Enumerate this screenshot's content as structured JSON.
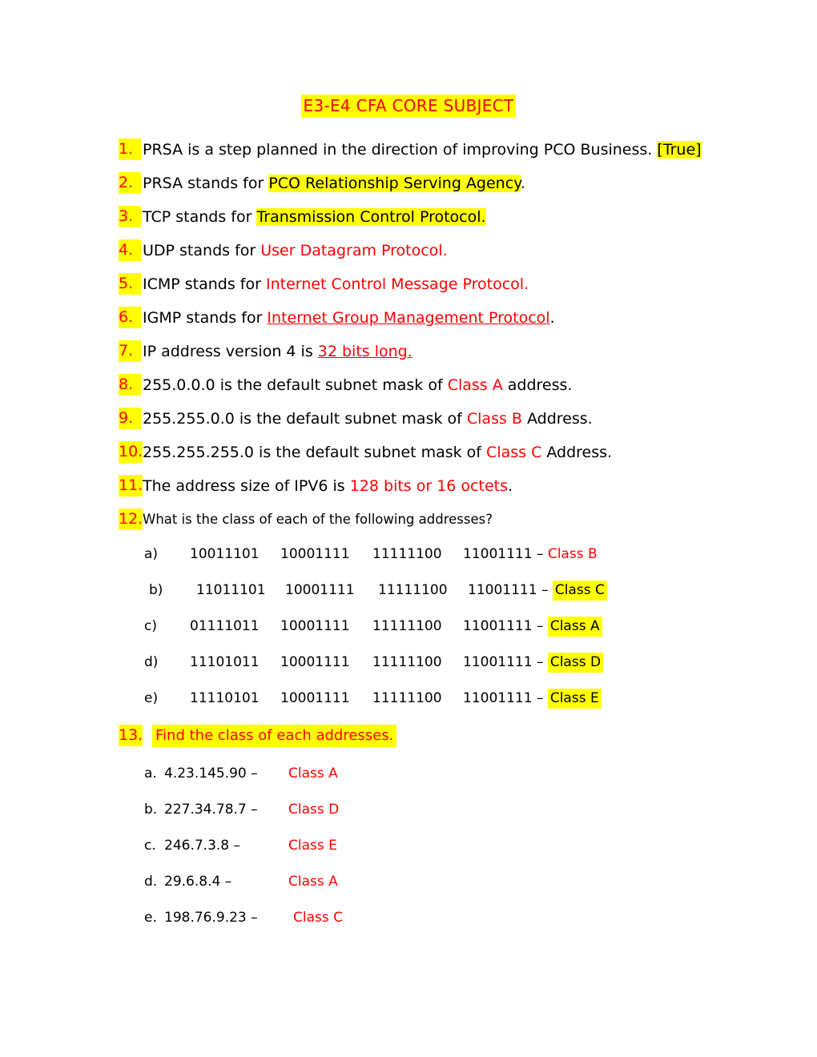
{
  "document": {
    "title": "E3-E4 CFA CORE SUBJECT",
    "colors": {
      "highlight": "#ffff00",
      "accent_red": "#ff0000",
      "text": "#000000",
      "page_background": "#ffffff"
    }
  },
  "questions": [
    {
      "number": "1.",
      "prefix": "PRSA is a step planned in the direction of improving PCO Business. ",
      "answer": "[True]",
      "suffix": ""
    },
    {
      "number": "2.",
      "prefix": "PRSA stands for ",
      "answer": "PCO Relationship Serving Agency",
      "suffix": "."
    },
    {
      "number": "3.",
      "prefix": "TCP stands for ",
      "answer": "Transmission Control Protocol.",
      "suffix": ""
    },
    {
      "number": "4.",
      "prefix": "UDP stands for ",
      "answer": "User Datagram Protocol.",
      "suffix": ""
    },
    {
      "number": "5.",
      "prefix": "ICMP stands for ",
      "answer": "Internet Control Message Protocol.",
      "suffix": ""
    },
    {
      "number": "6.",
      "prefix": "IGMP stands for ",
      "answer": "Internet Group Management Protocol",
      "suffix": "."
    },
    {
      "number": "7.",
      "prefix": "IP address version 4 is ",
      "answer": "32 bits long.",
      "suffix": ""
    },
    {
      "number": "8.",
      "prefix": "255.0.0.0 is the default subnet mask of ",
      "answer": "Class A",
      "suffix": " address."
    },
    {
      "number": "9.",
      "prefix": "255.255.0.0 is the default subnet mask of ",
      "answer": "Class B",
      "suffix": " Address."
    },
    {
      "number": "10.",
      "prefix": "255.255.255.0 is the default subnet mask of ",
      "answer": "Class C",
      "suffix": " Address."
    },
    {
      "number": "11.",
      "prefix": "The address size of IPV6 is ",
      "answer": "128 bits or 16 octets",
      "suffix": "."
    },
    {
      "number": "12.",
      "prefix": "What is the class of each of the following addresses?",
      "answer": "",
      "suffix": ""
    },
    {
      "number": "13.",
      "prefix": "Find the class of each addresses.",
      "answer": "",
      "suffix": ""
    }
  ],
  "binary_addresses": {
    "rows": [
      {
        "letter": "a)",
        "octet1": "10011101",
        "octet2": "10001111",
        "octet3": "11111100",
        "octet4": "11001111",
        "separator": "–",
        "answer": "Class B"
      },
      {
        "letter": "b)",
        "octet1": "11011101",
        "octet2": "10001111",
        "octet3": "11111100",
        "octet4": "11001111",
        "separator": "–",
        "answer": "Class C"
      },
      {
        "letter": "c)",
        "octet1": "01111011",
        "octet2": "10001111",
        "octet3": "11111100",
        "octet4": "11001111",
        "separator": "–",
        "answer": "Class A"
      },
      {
        "letter": "d)",
        "octet1": "11101011",
        "octet2": "10001111",
        "octet3": "11111100",
        "octet4": "11001111",
        "separator": "–",
        "answer": "Class D"
      },
      {
        "letter": "e)",
        "octet1": "11110101",
        "octet2": "10001111",
        "octet3": "11111100",
        "octet4": "11001111",
        "separator": "–",
        "answer": "Class E"
      }
    ]
  },
  "ip_addresses": {
    "rows": [
      {
        "letter": "a.",
        "address": "4.23.145.90 –",
        "answer": "Class A"
      },
      {
        "letter": "b.",
        "address": "227.34.78.7 –",
        "answer": "Class D"
      },
      {
        "letter": "c.",
        "address": "246.7.3.8 –",
        "answer": "Class E"
      },
      {
        "letter": "d.",
        "address": "29.6.8.4 –",
        "answer": "Class A"
      },
      {
        "letter": "e.",
        "address": "198.76.9.23 –",
        "answer": "Class C"
      }
    ]
  }
}
